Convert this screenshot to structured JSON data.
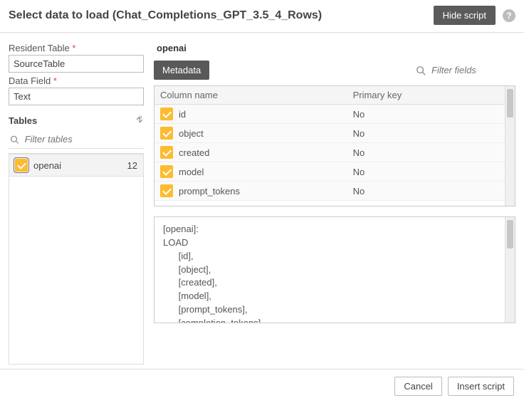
{
  "header": {
    "title": "Select data to load (Chat_Completions_GPT_3.5_4_Rows)",
    "hide_script": "Hide script"
  },
  "left": {
    "resident_label": "Resident Table",
    "resident_value": "SourceTable",
    "datafield_label": "Data Field",
    "datafield_value": "Text",
    "tables_header": "Tables",
    "filter_tables_placeholder": "Filter tables",
    "tables": [
      {
        "name": "openai",
        "count": "12",
        "checked": true
      }
    ]
  },
  "right": {
    "title": "openai",
    "metadata": "Metadata",
    "filter_fields_placeholder": "Filter fields",
    "columns": {
      "name_header": "Column name",
      "pk_header": "Primary key",
      "rows": [
        {
          "name": "id",
          "pk": "No"
        },
        {
          "name": "object",
          "pk": "No"
        },
        {
          "name": "created",
          "pk": "No"
        },
        {
          "name": "model",
          "pk": "No"
        },
        {
          "name": "prompt_tokens",
          "pk": "No"
        }
      ]
    },
    "script": "[openai]:\nLOAD\n      [id],\n      [object],\n      [created],\n      [model],\n      [prompt_tokens],\n      [completion_tokens],\n      [total_tokens],"
  },
  "footer": {
    "cancel": "Cancel",
    "insert": "Insert script"
  }
}
